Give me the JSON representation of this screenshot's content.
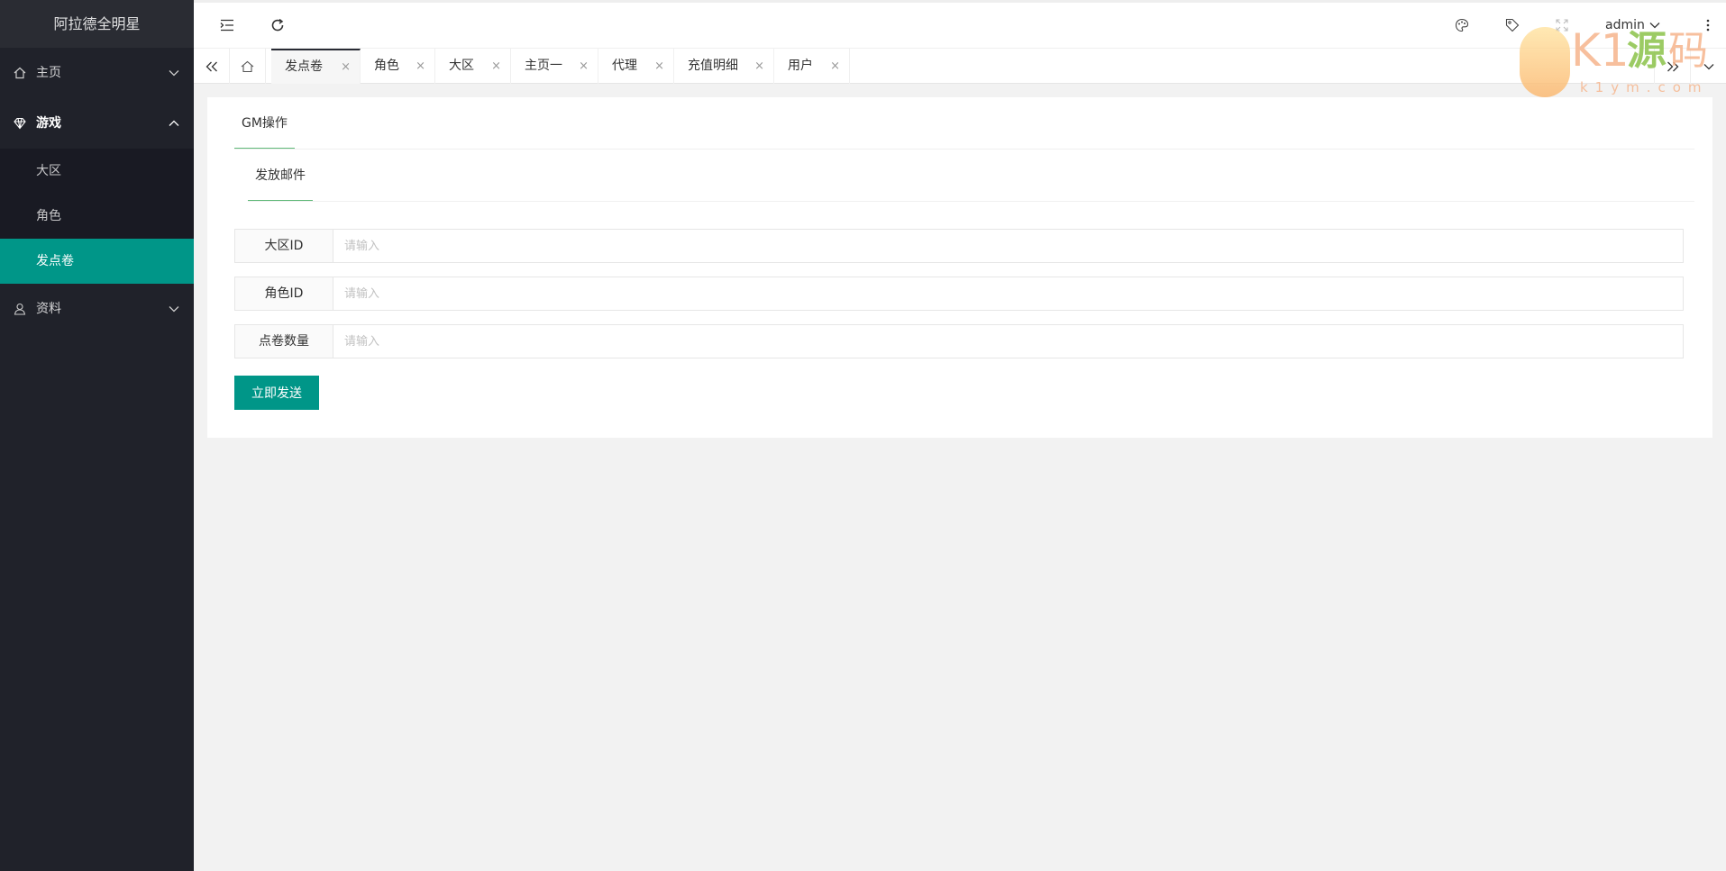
{
  "app": {
    "title": "阿拉德全明星"
  },
  "sidebar": {
    "items": [
      {
        "label": "主页",
        "icon": "home-icon",
        "expanded": false
      },
      {
        "label": "游戏",
        "icon": "diamond-icon",
        "expanded": true,
        "children": [
          {
            "label": "大区",
            "active": false
          },
          {
            "label": "角色",
            "active": false
          },
          {
            "label": "发点卷",
            "active": true
          }
        ]
      },
      {
        "label": "资料",
        "icon": "user-icon",
        "expanded": false
      }
    ]
  },
  "header": {
    "user": "admin",
    "icons": [
      "menu-fold-icon",
      "refresh-icon",
      "theme-icon",
      "tag-icon",
      "fullscreen-icon",
      "more-icon"
    ]
  },
  "tabs": {
    "items": [
      {
        "label": "发点卷",
        "active": true
      },
      {
        "label": "角色",
        "active": false
      },
      {
        "label": "大区",
        "active": false
      },
      {
        "label": "主页一",
        "active": false
      },
      {
        "label": "代理",
        "active": false
      },
      {
        "label": "充值明细",
        "active": false
      },
      {
        "label": "用户",
        "active": false
      }
    ],
    "close_symbol": "×"
  },
  "watermark": {
    "brand": "K1",
    "yuan": "源",
    "ma": "码",
    "url": "k1ym.com"
  },
  "main": {
    "outer_tab": "GM操作",
    "inner_tab": "发放邮件",
    "fields": [
      {
        "label": "大区ID",
        "placeholder": "请输入",
        "value": ""
      },
      {
        "label": "角色ID",
        "placeholder": "请输入",
        "value": ""
      },
      {
        "label": "点卷数量",
        "placeholder": "请输入",
        "value": ""
      }
    ],
    "submit_label": "立即发送"
  },
  "colors": {
    "sidebar_bg": "#20222a",
    "accent": "#009688",
    "tab_underline": "#5fb878"
  }
}
